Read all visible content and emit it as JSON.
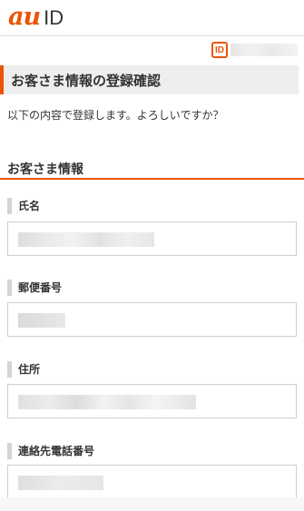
{
  "header": {
    "logo_au": "au",
    "logo_id": "ID"
  },
  "account": {
    "badge": "ID"
  },
  "page": {
    "title": "お客さま情報の登録確認",
    "intro": "以下の内容で登録します。よろしいですか？"
  },
  "section": {
    "title": "お客さま情報"
  },
  "fields": [
    {
      "label": "氏名"
    },
    {
      "label": "郵便番号"
    },
    {
      "label": "住所"
    },
    {
      "label": "連絡先電話番号"
    }
  ],
  "colors": {
    "accent": "#eb5505",
    "title_bg": "#eeeeee",
    "border": "#cfcfcf"
  }
}
